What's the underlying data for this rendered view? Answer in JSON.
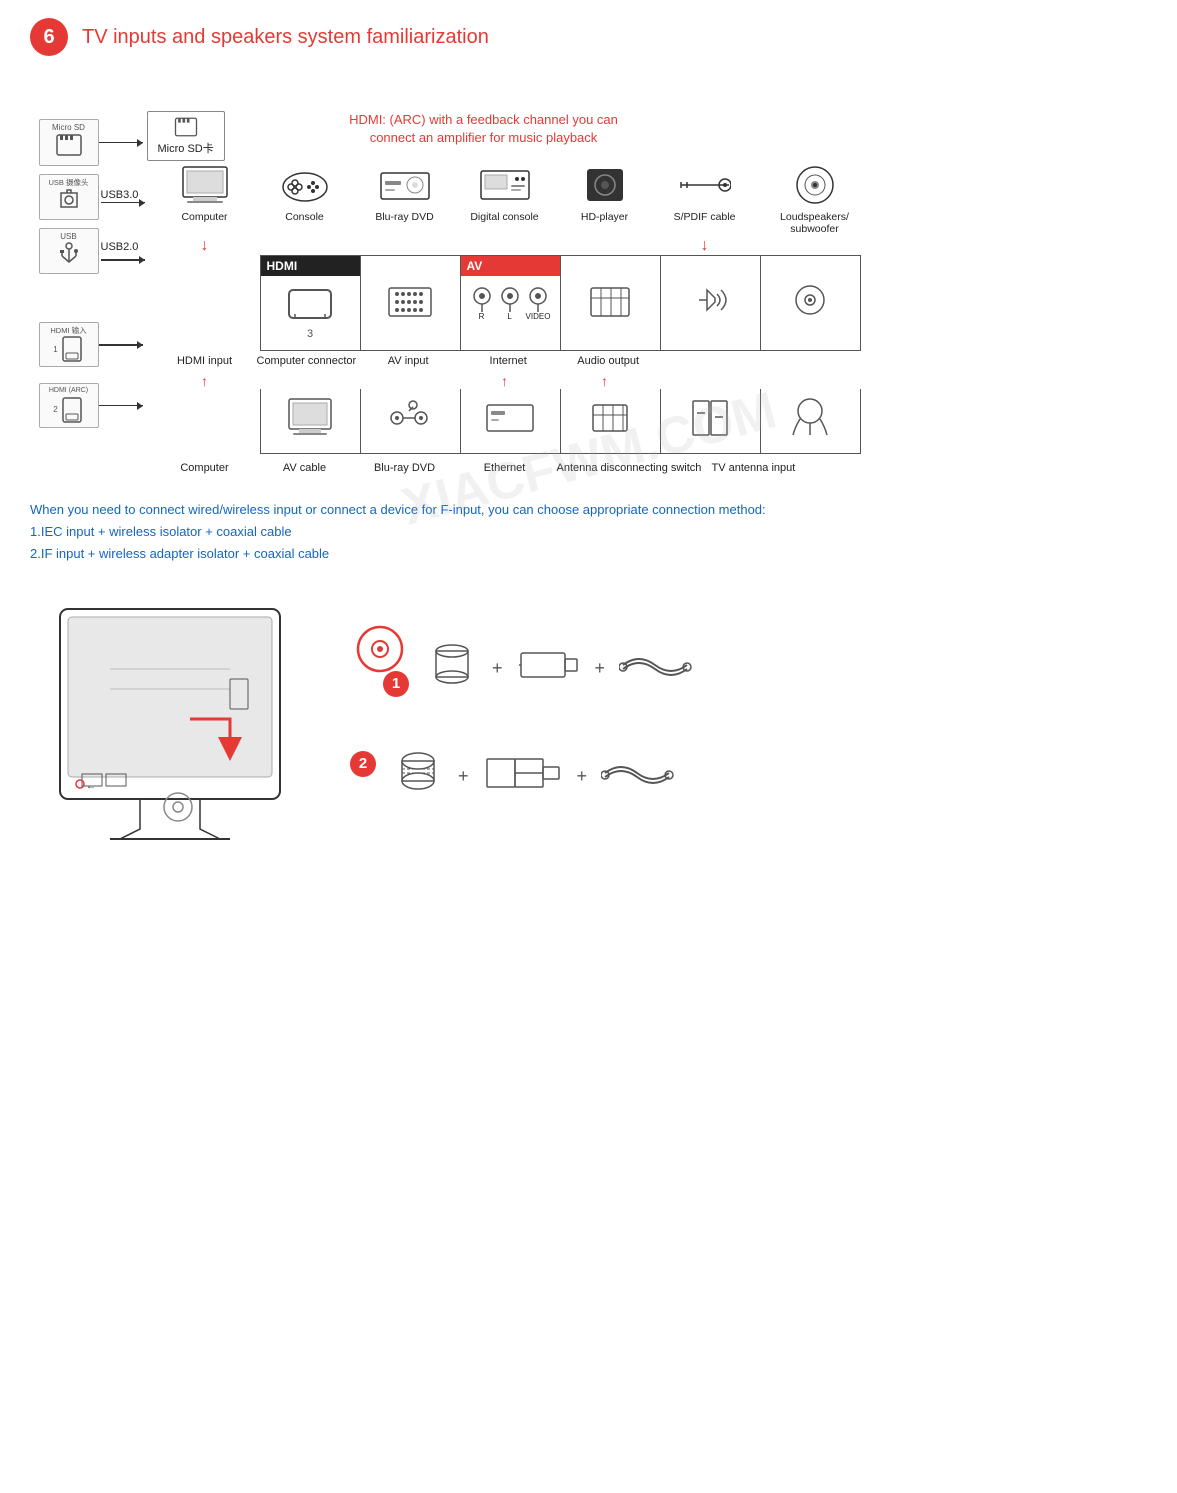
{
  "header": {
    "number": "6",
    "title": "TV inputs and speakers system familiarization"
  },
  "hdmi_callout": {
    "line1": "HDMI: (ARC) with a feedback channel you can",
    "line2": "connect an amplifier for music playback"
  },
  "left_icons": [
    {
      "label": "Micro SD",
      "icon": "💾",
      "sublabel": ""
    },
    {
      "label": "USB 摄像头",
      "icon": "🔌",
      "sublabel": ""
    },
    {
      "label": "USB",
      "icon": "🔌",
      "sublabel": ""
    },
    {
      "label": "HDMI 输入 1",
      "icon": "⬛",
      "sublabel": "1"
    },
    {
      "label": "HDMI (ARC) 2",
      "icon": "⬛",
      "sublabel": "2"
    }
  ],
  "port_labels": {
    "row1_hdrs": [
      "HDMI",
      "",
      "AV",
      "",
      ""
    ],
    "row1_port_numbers": [
      "3",
      "",
      "R  L  VIDEO",
      "",
      ""
    ],
    "row1_labels": [
      "HDMI input",
      "Computer connector",
      "AV input",
      "Internet",
      "Audio output"
    ],
    "row2_labels": [
      "Computer",
      "AV cable",
      "Blu-ray DVD",
      "Ethernet",
      "Antenna disconnecting switch",
      "TV antenna input"
    ]
  },
  "devices": [
    {
      "name": "Computer",
      "icon": "💻"
    },
    {
      "name": "Console",
      "icon": "🎮"
    },
    {
      "name": "Blu-ray DVD",
      "icon": "📀"
    },
    {
      "name": "Digital console",
      "icon": "📺"
    },
    {
      "name": "HD-player",
      "icon": "⬛"
    },
    {
      "name": "S/PDIF cable",
      "icon": "🔌"
    },
    {
      "name": "Loudspeakers/\nsubwoofer",
      "icon": "🔊"
    }
  ],
  "info_text": {
    "line0": "When you need to connect wired/wireless input or connect a device for F-input, you can choose appropriate connection method:",
    "line1": "1.IEC input + wireless isolator + coaxial cable",
    "line2": "2.IF input + wireless adapter isolator + coaxial cable"
  },
  "connection_options": [
    {
      "number": "1",
      "components": [
        "cylindrical-component",
        "adapter-component",
        "coaxial-cable"
      ]
    },
    {
      "number": "2",
      "components": [
        "flat-cylindrical",
        "block-adapter",
        "coaxial-cable"
      ]
    }
  ],
  "usb_labels": {
    "usb30": "USB3.0",
    "usb20": "USB2.0"
  },
  "micro_sd_label": "Micro SD卡",
  "watermark": "XIACFWM.COM"
}
